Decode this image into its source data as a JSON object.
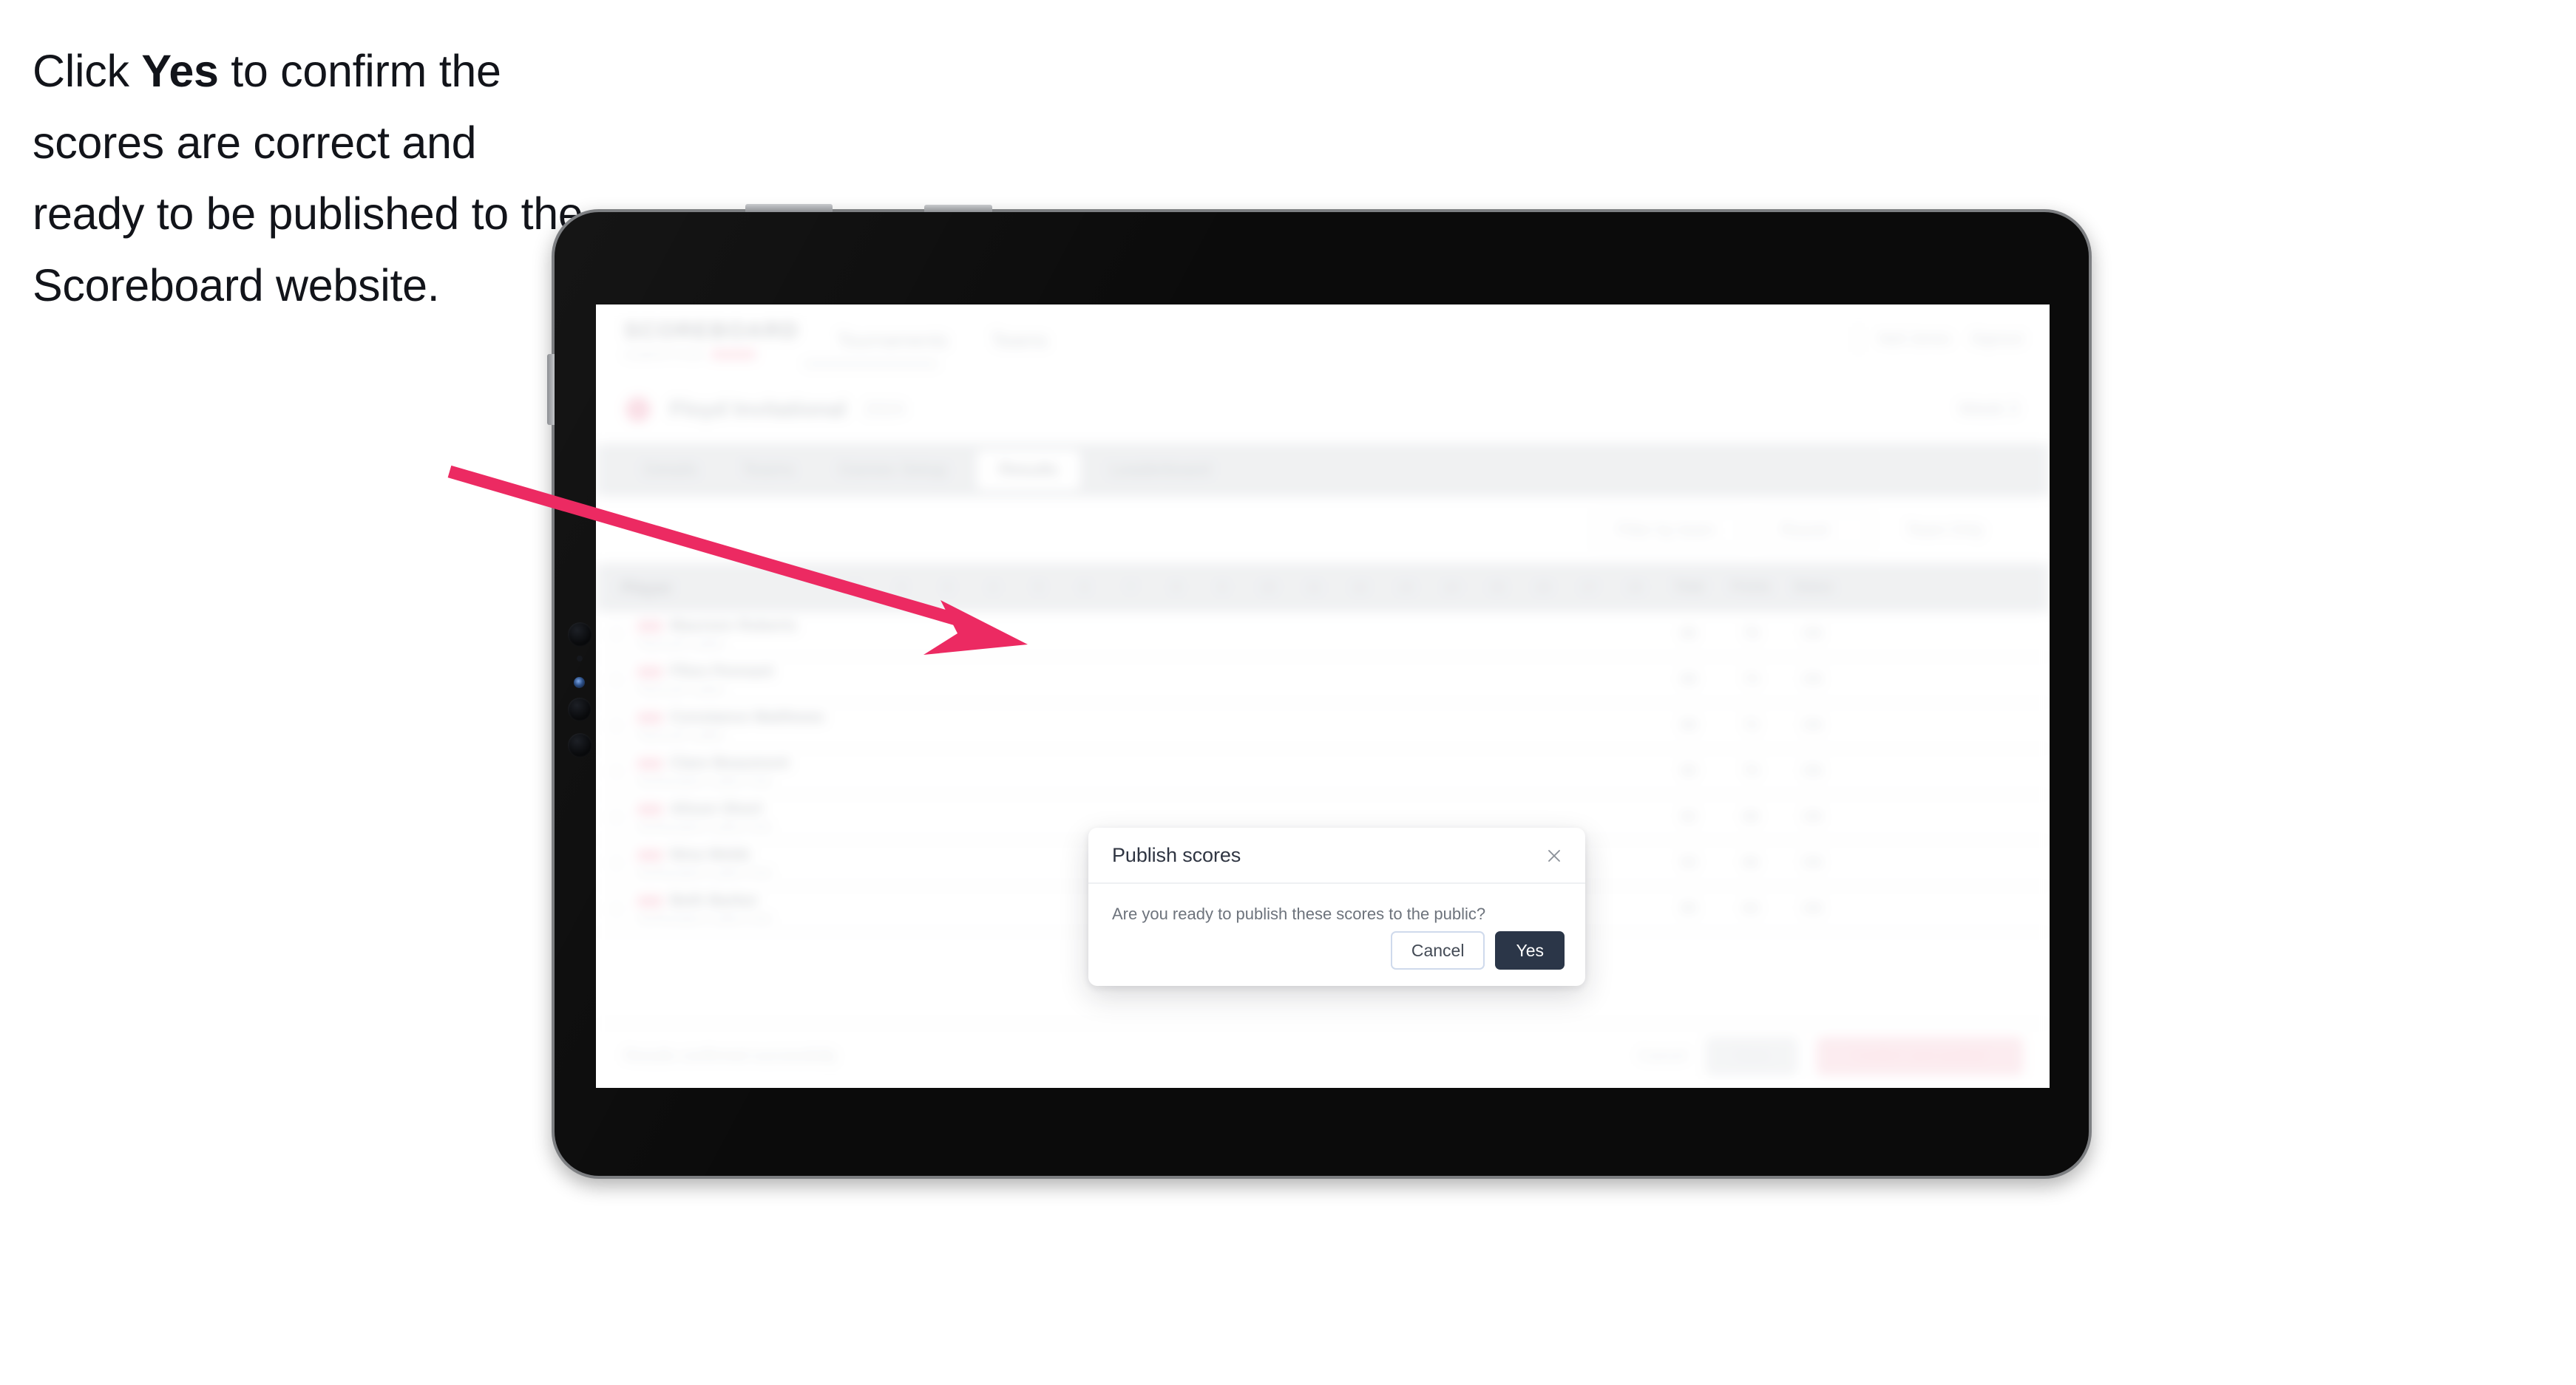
{
  "caption": {
    "part1": "Click ",
    "emphasis": "Yes",
    "part2": " to confirm the scores are correct and ready to be published to the Scoreboard website."
  },
  "colors": {
    "accent_pink": "#ec2a62",
    "primary_dark": "#2b3648",
    "cancel_border": "#cfdaec",
    "brand_pink": "#f7b9c9",
    "device_bezel": "#7d7f82",
    "device_body": "#0b0b0b"
  },
  "device": {
    "type": "tablet",
    "buttons": [
      "power-button",
      "volume-up-button",
      "left-rail-button"
    ],
    "camera": [
      "camera-lens-1",
      "camera-lens-2",
      "camera-lens-3",
      "camera-sensor-dot",
      "camera-flash"
    ]
  },
  "app": {
    "brand": {
      "word": "SCOREBOARD",
      "sub": "COMPETITION"
    },
    "nav": [
      {
        "label": "Tournaments"
      },
      {
        "label": "Teams"
      }
    ],
    "header_right": [
      {
        "label": "Neil Jones"
      },
      {
        "label": "Signout"
      }
    ],
    "title": {
      "heading": "Floyd Invitational",
      "sub": "2024",
      "right": "Week 3"
    },
    "tabs": [
      {
        "label": "Details",
        "active": false
      },
      {
        "label": "Teams",
        "active": false
      },
      {
        "label": "Games Setup",
        "active": false
      },
      {
        "label": "Results",
        "active": true
      },
      {
        "label": "Leaderboard",
        "active": false
      }
    ],
    "filters": [
      {
        "label": "Filter by team",
        "name": "filter-search"
      },
      {
        "label": "Round",
        "name": "filter-round"
      },
      {
        "label": "Team Only",
        "name": "filter-group"
      }
    ],
    "table": {
      "player_header": "Player",
      "hole_headers": [
        "1",
        "2",
        "3",
        "4",
        "5",
        "6",
        "7",
        "8",
        "9",
        "10",
        "11",
        "12",
        "13",
        "14",
        "15",
        "16",
        "17",
        "18"
      ],
      "wide_headers": [
        "Total",
        "Points",
        "Status"
      ],
      "rows": [
        {
          "badge": "AM",
          "name": "Maureen Roberts",
          "sub": "Plymouth Ladies",
          "total": "86",
          "points": "78",
          "status": "OK"
        },
        {
          "badge": "AM",
          "name": "Ffion Pennant",
          "sub": "Plymouth Ladies",
          "total": "88",
          "points": "74",
          "status": "OK"
        },
        {
          "badge": "AM",
          "name": "Constance Matthews",
          "sub": "Plymouth Ladies",
          "total": "89",
          "points": "72",
          "status": "OK"
        },
        {
          "badge": "AM",
          "name": "Clare Beaumont",
          "sub": "Northampton Ladies Club",
          "total": "90",
          "points": "70",
          "status": "OK"
        },
        {
          "badge": "AM",
          "name": "Alison Short",
          "sub": "Northampton Ladies Club",
          "total": "92",
          "points": "68",
          "status": "OK"
        },
        {
          "badge": "AM",
          "name": "Nina Webb",
          "sub": "Northampton Ladies Club",
          "total": "93",
          "points": "66",
          "status": "OK"
        },
        {
          "badge": "AM",
          "name": "Beth Barker",
          "sub": "Northampton Ladies Club",
          "total": "95",
          "points": "63",
          "status": "OK"
        }
      ]
    },
    "actionbar": {
      "note": "Results confirmed successfully",
      "link": "Cancel",
      "btn_secondary": "Save",
      "btn_primary": "Confirm and publish"
    }
  },
  "modal": {
    "title": "Publish scores",
    "message": "Are you ready to publish these scores to the public?",
    "cancel_label": "Cancel",
    "confirm_label": "Yes",
    "close_icon": "close-icon"
  }
}
